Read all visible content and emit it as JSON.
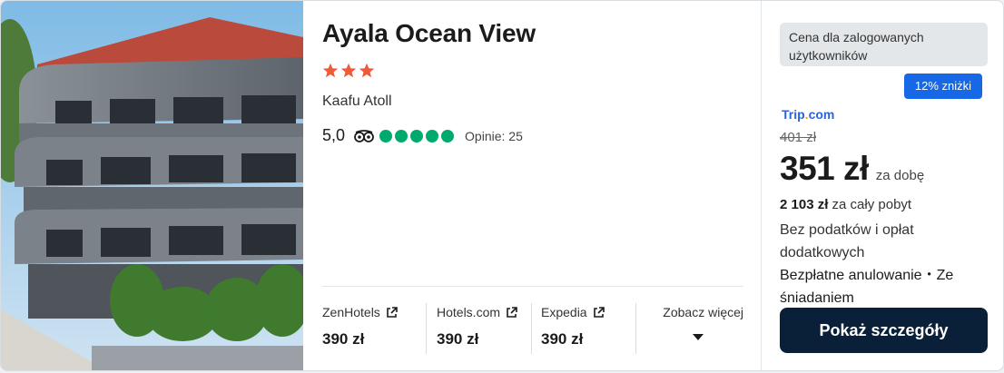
{
  "hotel": {
    "name": "Ayala Ocean View",
    "star_count": 3,
    "star_color": "#f05a36",
    "location": "Kaafu Atoll",
    "rating_score": "5,0",
    "rating_bubbles": 5,
    "reviews": "Opinie: 25"
  },
  "providers": [
    {
      "name": "ZenHotels",
      "price": "390 zł"
    },
    {
      "name": "Hotels.com",
      "price": "390 zł"
    },
    {
      "name": "Expedia",
      "price": "390 zł"
    }
  ],
  "see_more_label": "Zobacz więcej",
  "offer": {
    "member_note": "Cena dla zalogowanych użytkowników",
    "discount": "12% zniżki",
    "provider_name": "Trip",
    "provider_suffix": "com",
    "old_price": "401 zł",
    "price": "351 zł",
    "per_night": "za dobę",
    "total_amount": "2 103 zł",
    "total_label": "za cały pobyt",
    "taxes_note": "Bez podatków i opłat dodatkowych",
    "amenities": "Bezpłatne anulowanie・Ze śniadaniem",
    "button_label": "Pokaż szczegóły"
  },
  "colors": {
    "accent_blue": "#1768e6",
    "button_dark": "#0a1f38",
    "tripadvisor_green": "#00aa6c"
  }
}
